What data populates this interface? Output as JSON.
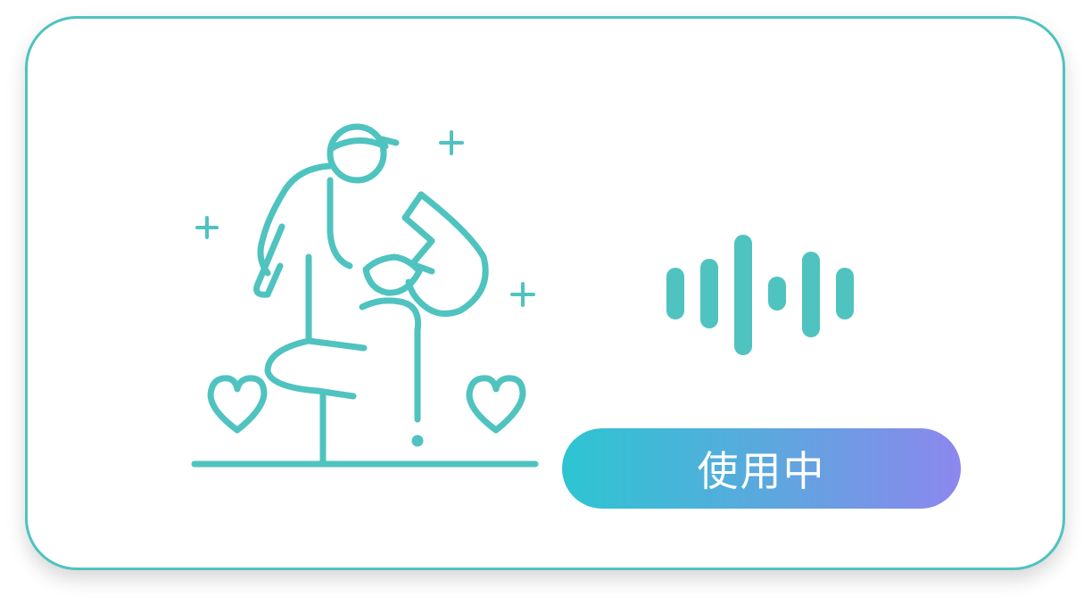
{
  "card": {
    "illustration_icon": "parent-lifting-child-icon",
    "voice_icon": "sound-wave-icon",
    "status_label": "使用中"
  },
  "colors": {
    "accent": "#4fc3bf",
    "pill_gradient_start": "#2dc5d2",
    "pill_gradient_end": "#8c87ee"
  }
}
